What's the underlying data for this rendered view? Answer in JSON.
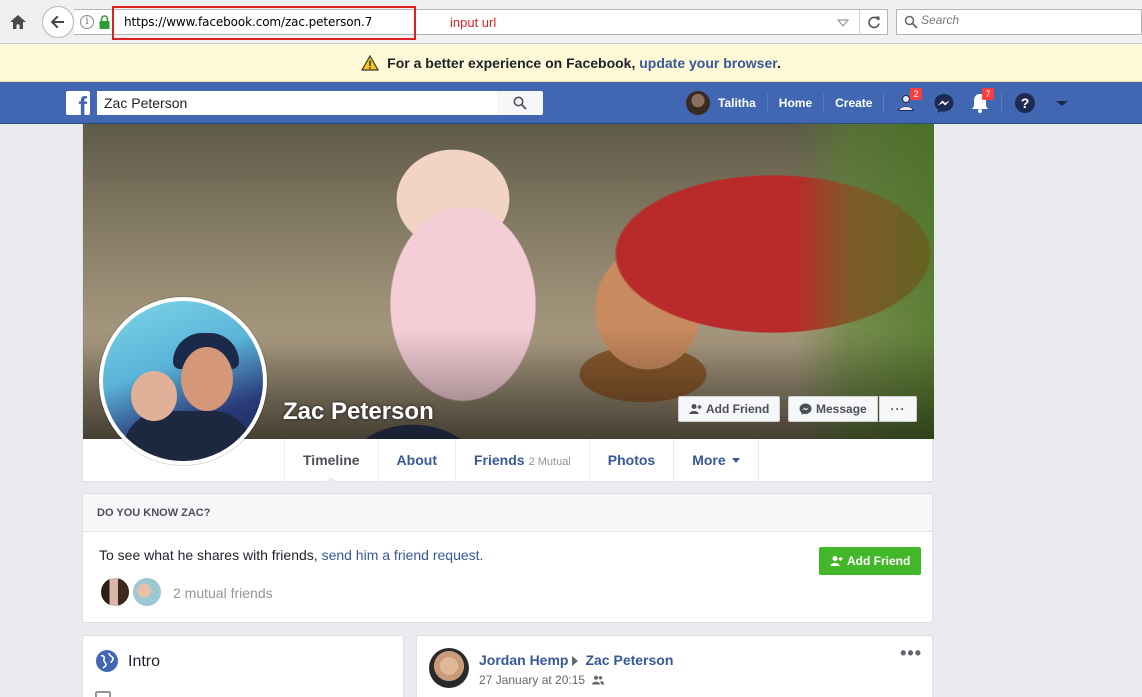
{
  "browser": {
    "url": "https://www.facebook.com/zac.peterson.7",
    "annotation": "input url",
    "search_placeholder": "Search"
  },
  "banner": {
    "text": "For a better experience on Facebook, ",
    "link": "update your browser",
    "end": "."
  },
  "fb_header": {
    "search_value": "Zac Peterson",
    "user_name": "Talitha",
    "home": "Home",
    "create": "Create",
    "friend_requests_badge": "2",
    "notifications_badge": "7"
  },
  "profile": {
    "name": "Zac Peterson",
    "add_friend": "Add Friend",
    "message": "Message",
    "more_dots": "···",
    "tabs": [
      {
        "label": "Timeline"
      },
      {
        "label": "About"
      },
      {
        "label": "Friends",
        "sub": "2 Mutual"
      },
      {
        "label": "Photos"
      },
      {
        "label": "More"
      }
    ]
  },
  "know": {
    "heading": "DO YOU KNOW ZAC?",
    "text": "To see what he shares with friends, ",
    "link": "send him a friend request.",
    "mutual": "2 mutual friends",
    "add_friend": "Add Friend"
  },
  "intro": {
    "title": "Intro"
  },
  "post": {
    "author": "Jordan Hemp",
    "target": "Zac Peterson",
    "date": "27 January at 20:15",
    "menu": "•••"
  },
  "colors": {
    "fb_blue": "#4267b2",
    "link": "#365899",
    "green": "#42b72a",
    "badge": "#fa3e3e",
    "highlight": "#e02020"
  }
}
